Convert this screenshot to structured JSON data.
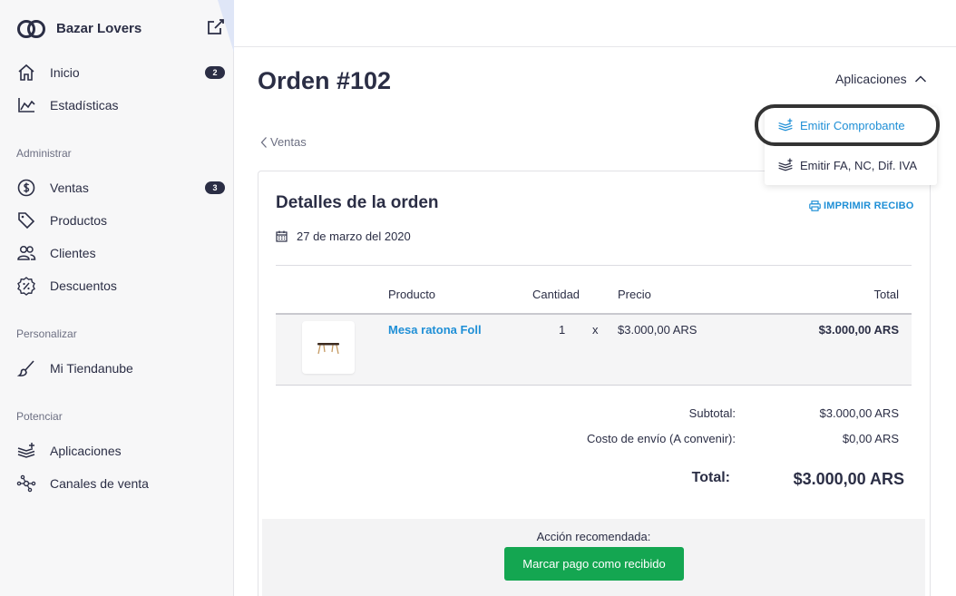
{
  "sidebar": {
    "brand": "Bazar Lovers",
    "nav": [
      {
        "label": "Inicio",
        "badge": "2"
      },
      {
        "label": "Estadísticas"
      }
    ],
    "sections": [
      {
        "title": "Administrar",
        "items": [
          {
            "label": "Ventas",
            "badge": "3"
          },
          {
            "label": "Productos"
          },
          {
            "label": "Clientes"
          },
          {
            "label": "Descuentos"
          }
        ]
      },
      {
        "title": "Personalizar",
        "items": [
          {
            "label": "Mi Tiendanube"
          }
        ]
      },
      {
        "title": "Potenciar",
        "items": [
          {
            "label": "Aplicaciones"
          },
          {
            "label": "Canales de venta"
          }
        ]
      }
    ]
  },
  "header": {
    "title": "Orden #102",
    "apps_toggle": "Aplicaciones",
    "back": "Ventas"
  },
  "apps_menu": [
    {
      "label": "Emitir Comprobante"
    },
    {
      "label": "Emitir FA, NC, Dif. IVA"
    }
  ],
  "order": {
    "title": "Detalles de la orden",
    "print": "IMPRIMIR RECIBO",
    "date": "27 de marzo del 2020",
    "columns": {
      "product": "Producto",
      "qty": "Cantidad",
      "price": "Precio",
      "total": "Total"
    },
    "items": [
      {
        "name": "Mesa ratona Foll",
        "qty": "1",
        "times": "x",
        "price": "$3.000,00 ARS",
        "total": "$3.000,00 ARS"
      }
    ],
    "summary": {
      "subtotal_label": "Subtotal:",
      "subtotal": "$3.000,00 ARS",
      "shipping_label": "Costo de envío (A convenir):",
      "shipping": "$0,00 ARS",
      "total_label": "Total:",
      "total": "$3.000,00 ARS"
    },
    "action": {
      "label": "Acción recomendada:",
      "button": "Marcar pago como recibido"
    }
  },
  "colors": {
    "primary_text": "#2b2e45",
    "link": "#1f8fd6",
    "success": "#14a651"
  }
}
